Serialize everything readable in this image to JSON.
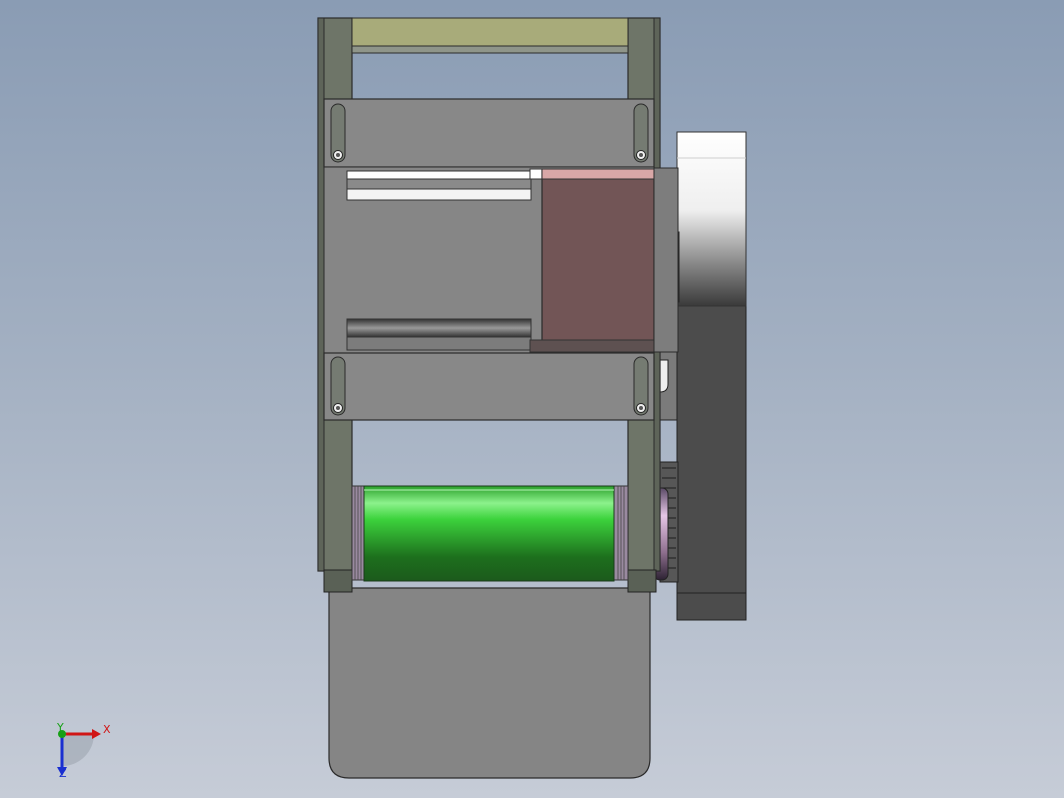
{
  "viewport": {
    "background_top": "#8a9cb4",
    "background_bottom": "#c6ccd7"
  },
  "model": {
    "frame_color": "#6e7568",
    "plate_color": "#888888",
    "motor_body_color": "#725556",
    "roller_color": "#2ea42e",
    "belt_top_color": "#a8ab7a",
    "pulley_housing_color": "#4c4c4c",
    "disc_color": "#f2f2f2",
    "tray_color": "#858585",
    "icons": [
      "mounting-slot-icon",
      "triad-origin-icon"
    ]
  },
  "triad": {
    "x_label": "X",
    "y_label": "Y",
    "z_label": "Z",
    "x_color": "#d01515",
    "y_color": "#16a016",
    "z_color": "#1a2fd0"
  }
}
